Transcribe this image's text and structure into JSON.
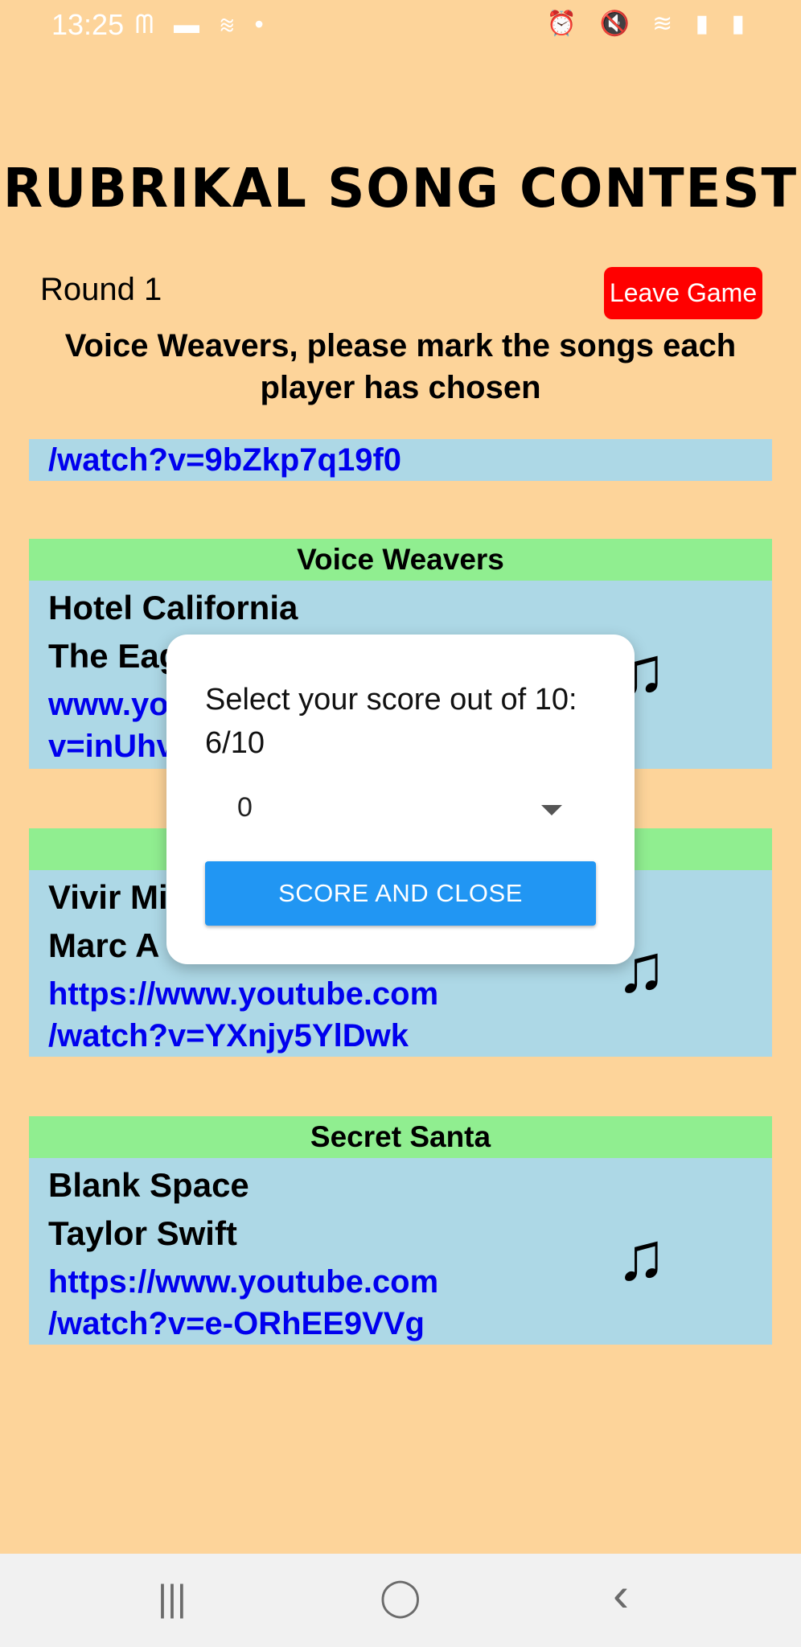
{
  "status_bar": {
    "time": "13:25",
    "left_icons": [
      "messenger-icon",
      "chat-icon",
      "wifi-icon",
      "dot-icon"
    ],
    "right_icons": [
      "alarm-icon",
      "mute-icon",
      "wifi-icon",
      "signal-icon",
      "battery-icon"
    ]
  },
  "app": {
    "title": "RUBRIKAL SONG CONTEST",
    "round_label": "Round 1",
    "leave_button": "Leave Game",
    "instruction": "Voice Weavers, please mark the songs each player has chosen"
  },
  "partial_card": {
    "link": "/watch?v=9bZkp7q19f0"
  },
  "cards": [
    {
      "player": "Voice Weavers",
      "song": "Hotel California",
      "artist": "The Eag",
      "link_line1": "www.yo",
      "link_line2": "v=inUhv",
      "icon": "music-note-icon"
    },
    {
      "player": "",
      "song": "Vivir Mi",
      "artist": "Marc A",
      "link_line1": "https://www.youtube.com",
      "link_line2": "/watch?v=YXnjy5YlDwk",
      "icon": "music-note-icon"
    },
    {
      "player": "Secret Santa",
      "song": "Blank Space",
      "artist": "Taylor Swift",
      "link_line1": "https://www.youtube.com",
      "link_line2": "/watch?v=e-ORhEE9VVg",
      "icon": "music-note-icon"
    }
  ],
  "dialog": {
    "title": "Select your score out of 10: 6/10",
    "select_value": "0",
    "button": "SCORE AND CLOSE"
  },
  "nav_bar": {
    "recents": "|||",
    "home": "◯",
    "back": "‹"
  },
  "colors": {
    "background": "#fdd49a",
    "card": "#add8e6",
    "player_header": "#90ee90",
    "leave_button": "#ff0000",
    "dialog_button": "#2196f3",
    "link": "#0000ee"
  }
}
